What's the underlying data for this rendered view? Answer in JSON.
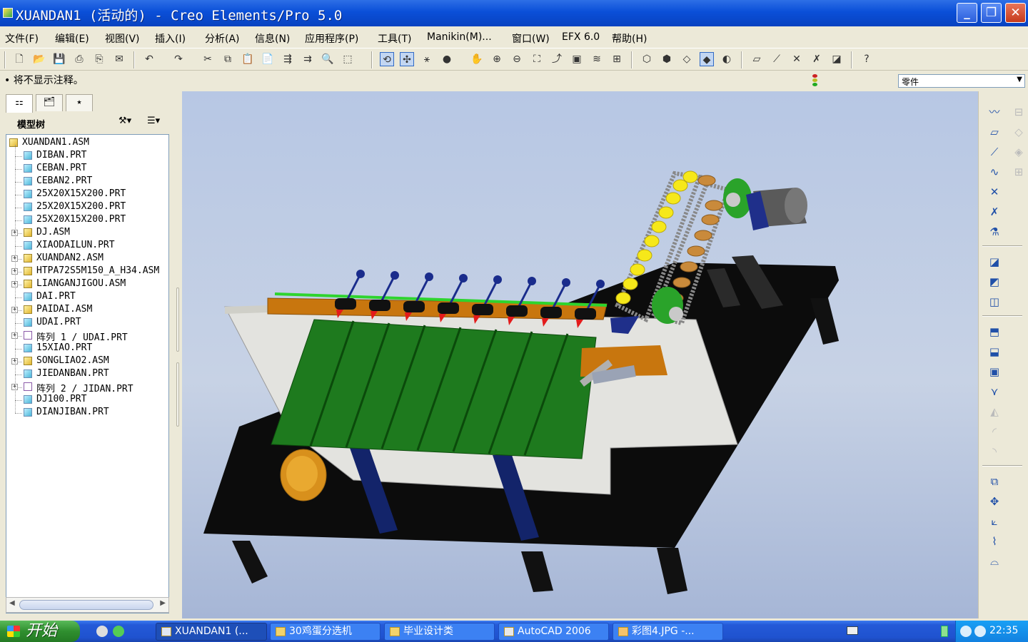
{
  "window": {
    "title": "XUANDAN1 (活动的) - Creo Elements/Pro 5.0",
    "minimize_glyph": "_",
    "restore_glyph": "❐",
    "close_glyph": "✕"
  },
  "menu": {
    "items": [
      "文件(F)",
      "编辑(E)",
      "视图(V)",
      "插入(I)",
      "分析(A)",
      "信息(N)",
      "应用程序(P)",
      "工具(T)",
      "Manikin(M)...",
      "窗口(W)",
      "EFX 6.0",
      "帮助(H)"
    ]
  },
  "toolbar": {
    "icons": [
      "new-icon",
      "open-icon",
      "save-icon",
      "print-icon",
      "print-preview-icon",
      "email-icon",
      "undo-icon",
      "redo-icon",
      "cut-icon",
      "copy-icon",
      "paste-icon",
      "paste-special-icon",
      "regenerate-icon",
      "regenerate-manager-icon",
      "find-icon",
      "select-box-icon",
      "repaint-icon",
      "spin-center-icon",
      "orient-mode-icon",
      "appearance-icon",
      "pan-icon",
      "zoom-in-icon",
      "zoom-out-icon",
      "refit-icon",
      "reorient-icon",
      "saved-views-icon",
      "layers-icon",
      "view-manager-icon",
      "wireframe-icon",
      "hidden-line-icon",
      "no-hidden-icon",
      "shading-icon",
      "shading-edges-icon",
      "datum-plane-display-icon",
      "datum-axis-display-icon",
      "point-display-icon",
      "csys-display-icon",
      "annotation-display-icon",
      "context-help-icon"
    ]
  },
  "message": {
    "text": "• 将不显示注释。",
    "filter_value": "零件"
  },
  "model_tree": {
    "header": "模型树",
    "items": [
      {
        "label": "XUANDAN1.ASM",
        "type": "asm",
        "level": 0,
        "expandable": false
      },
      {
        "label": "DIBAN.PRT",
        "type": "part",
        "level": 1,
        "expandable": false
      },
      {
        "label": "CEBAN.PRT",
        "type": "part",
        "level": 1,
        "expandable": false
      },
      {
        "label": "CEBAN2.PRT",
        "type": "part",
        "level": 1,
        "expandable": false
      },
      {
        "label": "25X20X15X200.PRT",
        "type": "part",
        "level": 1,
        "expandable": false
      },
      {
        "label": "25X20X15X200.PRT",
        "type": "part",
        "level": 1,
        "expandable": false
      },
      {
        "label": "25X20X15X200.PRT",
        "type": "part",
        "level": 1,
        "expandable": false
      },
      {
        "label": "DJ.ASM",
        "type": "asm",
        "level": 1,
        "expandable": true
      },
      {
        "label": "XIAODAILUN.PRT",
        "type": "part",
        "level": 1,
        "expandable": false
      },
      {
        "label": "XUANDAN2.ASM",
        "type": "asm",
        "level": 1,
        "expandable": true
      },
      {
        "label": "HTPA72S5M150_A_H34.ASM",
        "type": "asm",
        "level": 1,
        "expandable": true
      },
      {
        "label": "LIANGANJIGOU.ASM",
        "type": "asm",
        "level": 1,
        "expandable": true
      },
      {
        "label": "DAI.PRT",
        "type": "part",
        "level": 1,
        "expandable": false
      },
      {
        "label": "PAIDAI.ASM",
        "type": "asm",
        "level": 1,
        "expandable": true
      },
      {
        "label": "UDAI.PRT",
        "type": "part",
        "level": 1,
        "expandable": false
      },
      {
        "label": "阵列 1 / UDAI.PRT",
        "type": "pattern",
        "level": 1,
        "expandable": true
      },
      {
        "label": "15XIAO.PRT",
        "type": "part",
        "level": 1,
        "expandable": false
      },
      {
        "label": "SONGLIAO2.ASM",
        "type": "asm",
        "level": 1,
        "expandable": true
      },
      {
        "label": "JIEDANBAN.PRT",
        "type": "part",
        "level": 1,
        "expandable": false
      },
      {
        "label": "阵列 2 / JIDAN.PRT",
        "type": "pattern",
        "level": 1,
        "expandable": true
      },
      {
        "label": "DJ100.PRT",
        "type": "part",
        "level": 1,
        "expandable": false
      },
      {
        "label": "DIANJIBAN.PRT",
        "type": "part",
        "level": 1,
        "expandable": false
      }
    ]
  },
  "right_toolbar": {
    "icons": [
      "sketch-icon",
      "plane-icon",
      "axis-icon",
      "curve-icon",
      "point-icon",
      "csys-icon",
      "analysis-feature-icon",
      "assemble-icon",
      "create-component-icon",
      "package-icon",
      "mirror-icon",
      "shrinkwrap-icon",
      "pattern-icon",
      "merge-icon",
      "trim-icon",
      "extend-icon",
      "offset-icon",
      "thicken-icon",
      "solidify-icon",
      "flatten-icon"
    ]
  },
  "colors": {
    "title_bar": "#0a4fd8",
    "viewport_top": "#b7c7e4",
    "table": "#0c0c0c",
    "panel": "#e1e1dc",
    "green_chute": "#1e7a1e",
    "orange_board": "#c8760e",
    "yellow_egg": "#f6e81a"
  },
  "taskbar": {
    "start_label": "开始",
    "tasks": [
      {
        "label": "XUANDAN1 (...",
        "active": true
      },
      {
        "label": "30鸡蛋分选机",
        "active": false
      },
      {
        "label": "毕业设计类",
        "active": false
      },
      {
        "label": "AutoCAD 2006",
        "active": false
      },
      {
        "label": "彩图4.JPG -...",
        "active": false
      }
    ],
    "clock": "22:35"
  }
}
